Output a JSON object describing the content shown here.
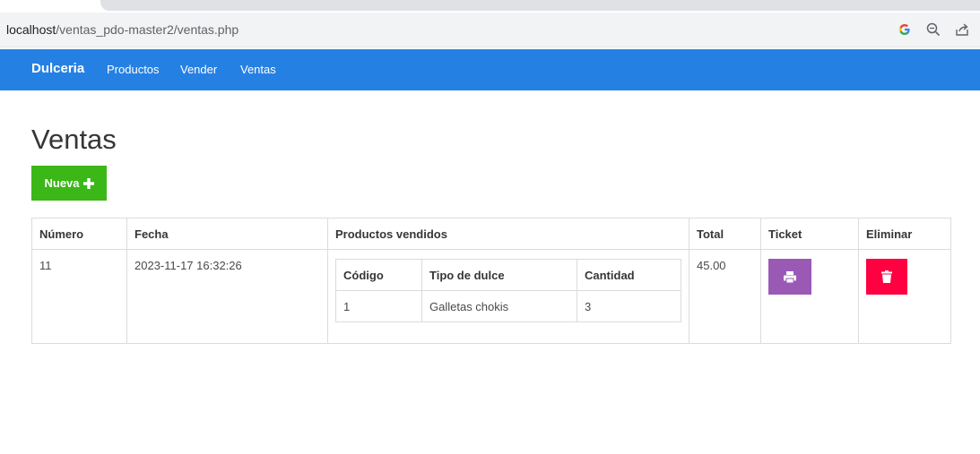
{
  "browser": {
    "url_host": "localhost",
    "url_path": "/ventas_pdo-master2/ventas.php"
  },
  "navbar": {
    "brand": "Dulceria",
    "links": [
      "Productos",
      "Vender",
      "Ventas"
    ],
    "color": "#2580e3"
  },
  "page": {
    "title": "Ventas",
    "new_button_label": "Nueva",
    "new_button_color": "#3bb717"
  },
  "table": {
    "headers": [
      "Número",
      "Fecha",
      "Productos vendidos",
      "Total",
      "Ticket",
      "Eliminar"
    ],
    "rows": [
      {
        "numero": "11",
        "fecha": "2023-11-17 16:32:26",
        "productos": {
          "headers": [
            "Código",
            "Tipo de dulce",
            "Cantidad"
          ],
          "rows": [
            {
              "codigo": "1",
              "tipo": "Galletas chokis",
              "cantidad": "3"
            }
          ]
        },
        "total": "45.00",
        "ticket_icon": "print-icon",
        "delete_icon": "trash-icon"
      }
    ]
  },
  "colors": {
    "ticket_button": "#9b59b6",
    "delete_button": "#ff0040"
  }
}
